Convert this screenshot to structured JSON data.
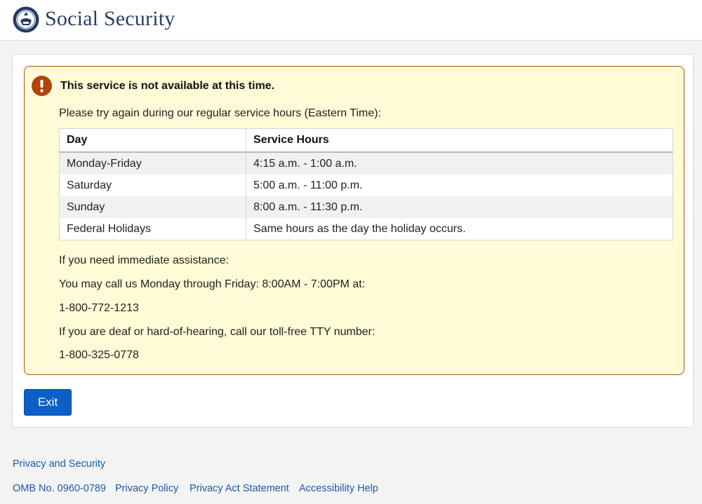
{
  "header": {
    "brand_title": "Social Security",
    "logo_icon": "ssa-seal-icon"
  },
  "alert": {
    "icon": "exclamation-circle-icon",
    "title": "This service is not available at this time.",
    "intro": "Please try again during our regular service hours (Eastern Time):",
    "table": {
      "headers": [
        "Day",
        "Service Hours"
      ],
      "rows": [
        {
          "day": "Monday-Friday",
          "hours": "4:15 a.m. - 1:00 a.m."
        },
        {
          "day": "Saturday",
          "hours": "5:00 a.m. - 11:00 p.m."
        },
        {
          "day": "Sunday",
          "hours": "8:00 a.m. - 11:30 p.m."
        },
        {
          "day": "Federal Holidays",
          "hours": "Same hours as the day the holiday occurs."
        }
      ]
    },
    "assistance_heading": "If you need immediate assistance:",
    "call_text": "You may call us Monday through Friday: 8:00AM - 7:00PM at:",
    "phone": "1-800-772-1213",
    "tty_text": "If you are deaf or hard-of-hearing, call our toll-free TTY number:",
    "tty_phone": "1-800-325-0778"
  },
  "exit_button": {
    "label": "Exit"
  },
  "footer": {
    "privacy_security": "Privacy and Security",
    "links": [
      "OMB No. 0960-0789",
      "Privacy Policy",
      "Privacy Act Statement",
      "Accessibility Help"
    ]
  },
  "colors": {
    "brand": "#2a3f61",
    "alert_bg": "#fffbd6",
    "alert_border": "#a35a14",
    "alert_icon": "#b0450b",
    "button": "#0b5fc6",
    "link": "#1c5aa8"
  }
}
